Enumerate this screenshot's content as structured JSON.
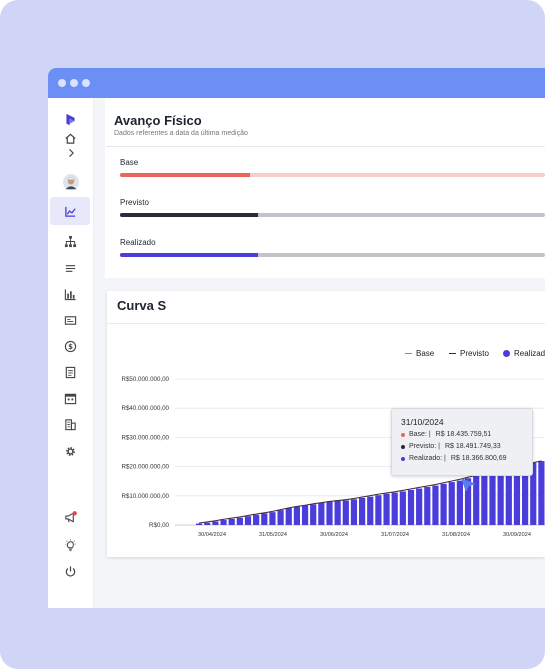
{
  "colors": {
    "accent": "#4a3ddb",
    "base": "#e8675a",
    "base_track": "#f5cfcb",
    "previsto": "#2b2a3a",
    "previsto_track": "#c4c3cc",
    "realizado": "#4a3ddb",
    "realizado_track": "#c4c3cc",
    "titlebar": "#6c8ff5"
  },
  "sidebar": {
    "icons": [
      "logo-icon",
      "home-icon",
      "chevron-right-icon",
      "avatar",
      "chart-line-icon",
      "org-chart-icon",
      "list-icon",
      "bar-chart-icon",
      "card-icon",
      "dollar-icon",
      "document-icon",
      "calendar-icon",
      "building-icon",
      "gear-icon",
      "megaphone-icon",
      "lightbulb-icon",
      "power-icon"
    ]
  },
  "header": {
    "title": "Avanço Físico",
    "subtitle": "Dados referentes a data da última medição"
  },
  "progress": [
    {
      "label": "Base",
      "fraction": 0.305
    },
    {
      "label": "Previsto",
      "fraction": 0.325
    },
    {
      "label": "Realizado",
      "fraction": 0.325
    }
  ],
  "chart_title": "Curva S",
  "legend": {
    "base": "Base",
    "previsto": "Previsto",
    "realizado": "Realizado"
  },
  "chart_data": {
    "type": "bar",
    "title": "Curva S",
    "ylim": [
      0,
      50000000
    ],
    "y_ticks": [
      "R$0,00",
      "R$10.000.000,00",
      "R$20.000.000,00",
      "R$30.000.000,00",
      "R$40.000.000,00",
      "R$50.000.000,00"
    ],
    "x_ticks": [
      "30/04/2024",
      "31/05/2024",
      "30/06/2024",
      "31/07/2024",
      "31/08/2024",
      "30/09/2024"
    ],
    "series": [
      {
        "name": "Realizado",
        "kind": "bar",
        "values": [
          500000,
          800000,
          1200000,
          1700000,
          2100000,
          2500000,
          3000000,
          3500000,
          4000000,
          4400000,
          5100000,
          5800000,
          6300000,
          6700000,
          7100000,
          7600000,
          7900000,
          8200000,
          8400000,
          8800000,
          9300000,
          9700000,
          10200000,
          10700000,
          11100000,
          11500000,
          12000000,
          12500000,
          13000000,
          13500000,
          14100000,
          14700000,
          15200000,
          16000000,
          16800000,
          17500000,
          18366800,
          19000000,
          19700000,
          20300000,
          20800000,
          21300000,
          21900000
        ]
      },
      {
        "name": "Base",
        "kind": "line",
        "values": [
          700000,
          1100000,
          1500000,
          2000000,
          2400000,
          2800000,
          3300000,
          3800000,
          4200000,
          4700000,
          5300000,
          5900000,
          6400000,
          6800000,
          7300000,
          7700000,
          8100000,
          8400000,
          8700000,
          9100000,
          9600000,
          10100000,
          10600000,
          11000000,
          11400000,
          11900000,
          12400000,
          12900000,
          13400000,
          13900000,
          14500000,
          15100000,
          15700000,
          16400000,
          17100000,
          17800000,
          18435759,
          19100000,
          19800000,
          20400000,
          20900000,
          21400000,
          22000000
        ]
      },
      {
        "name": "Previsto",
        "kind": "line",
        "values": [
          650000,
          1050000,
          1450000,
          1950000,
          2350000,
          2750000,
          3250000,
          3750000,
          4150000,
          4650000,
          5250000,
          5850000,
          6350000,
          6750000,
          7250000,
          7650000,
          8050000,
          8350000,
          8650000,
          9050000,
          9550000,
          10050000,
          10550000,
          10950000,
          11350000,
          11850000,
          12350000,
          12850000,
          13350000,
          13850000,
          14450000,
          15050000,
          15650000,
          16350000,
          17050000,
          17750000,
          18491749,
          19050000,
          19750000,
          20350000,
          20850000,
          21350000,
          21950000
        ]
      }
    ]
  },
  "tooltip": {
    "date": "31/10/2024",
    "rows": [
      {
        "label": "Base: |",
        "value": "R$ 18.435.759,51",
        "color": "#e8675a"
      },
      {
        "label": "Previsto: |",
        "value": "R$ 18.491.749,33",
        "color": "#2b2a3a"
      },
      {
        "label": "Realizado: |",
        "value": "R$ 18.366.800,69",
        "color": "#4a3ddb"
      }
    ]
  }
}
